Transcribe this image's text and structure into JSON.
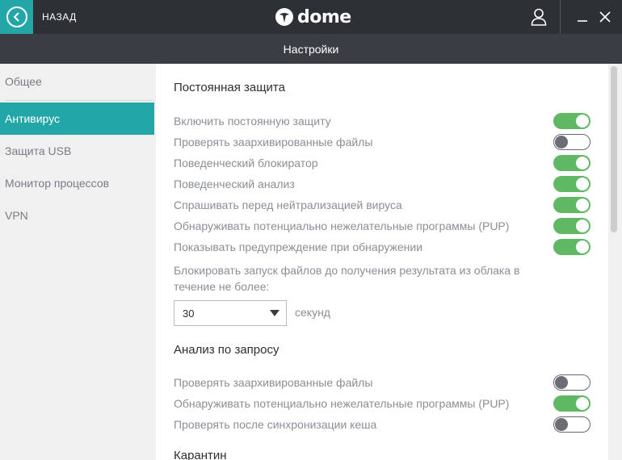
{
  "titlebar": {
    "back_label": "НАЗАД",
    "logo_text": "dome",
    "icons": {
      "back": "chevron-left-icon",
      "user": "user-icon",
      "minimize": "minimize-icon",
      "close": "close-icon"
    }
  },
  "header": {
    "title": "Настройки"
  },
  "sidebar": {
    "items": [
      {
        "label": "Общее",
        "active": false
      },
      {
        "label": "Антивирус",
        "active": true
      },
      {
        "label": "Защита USB",
        "active": false
      },
      {
        "label": "Монитор процессов",
        "active": false
      },
      {
        "label": "VPN",
        "active": false
      }
    ]
  },
  "realtime": {
    "title": "Постоянная защита",
    "options": [
      {
        "label": "Включить постоянную защиту",
        "on": true
      },
      {
        "label": "Проверять заархивированные файлы",
        "on": false
      },
      {
        "label": "Поведенческий блокиратор",
        "on": true
      },
      {
        "label": "Поведенческий анализ",
        "on": true
      },
      {
        "label": "Спрашивать перед нейтрализацией вируса",
        "on": true
      },
      {
        "label": "Обнаруживать потенциально нежелательные программы (PUP)",
        "on": true
      },
      {
        "label": "Показывать предупреждение при обнаружении",
        "on": true
      }
    ],
    "block_text": "Блокировать запуск файлов до получения результата из облака в течение не более:",
    "timeout_value": "30",
    "timeout_unit": "секунд"
  },
  "ondemand": {
    "title": "Анализ по запросу",
    "options": [
      {
        "label": "Проверять заархивированные файлы",
        "on": false
      },
      {
        "label": "Обнаруживать потенциально нежелательные программы (PUP)",
        "on": true
      },
      {
        "label": "Проверять после синхронизации кеша",
        "on": false
      }
    ]
  },
  "quarantine": {
    "title": "Карантин"
  },
  "colors": {
    "accent": "#22a6a8",
    "titlebar": "#2d3035",
    "header": "#3a3e44",
    "toggle_on": "#5fb862",
    "toggle_off_knob": "#6b6f75"
  }
}
